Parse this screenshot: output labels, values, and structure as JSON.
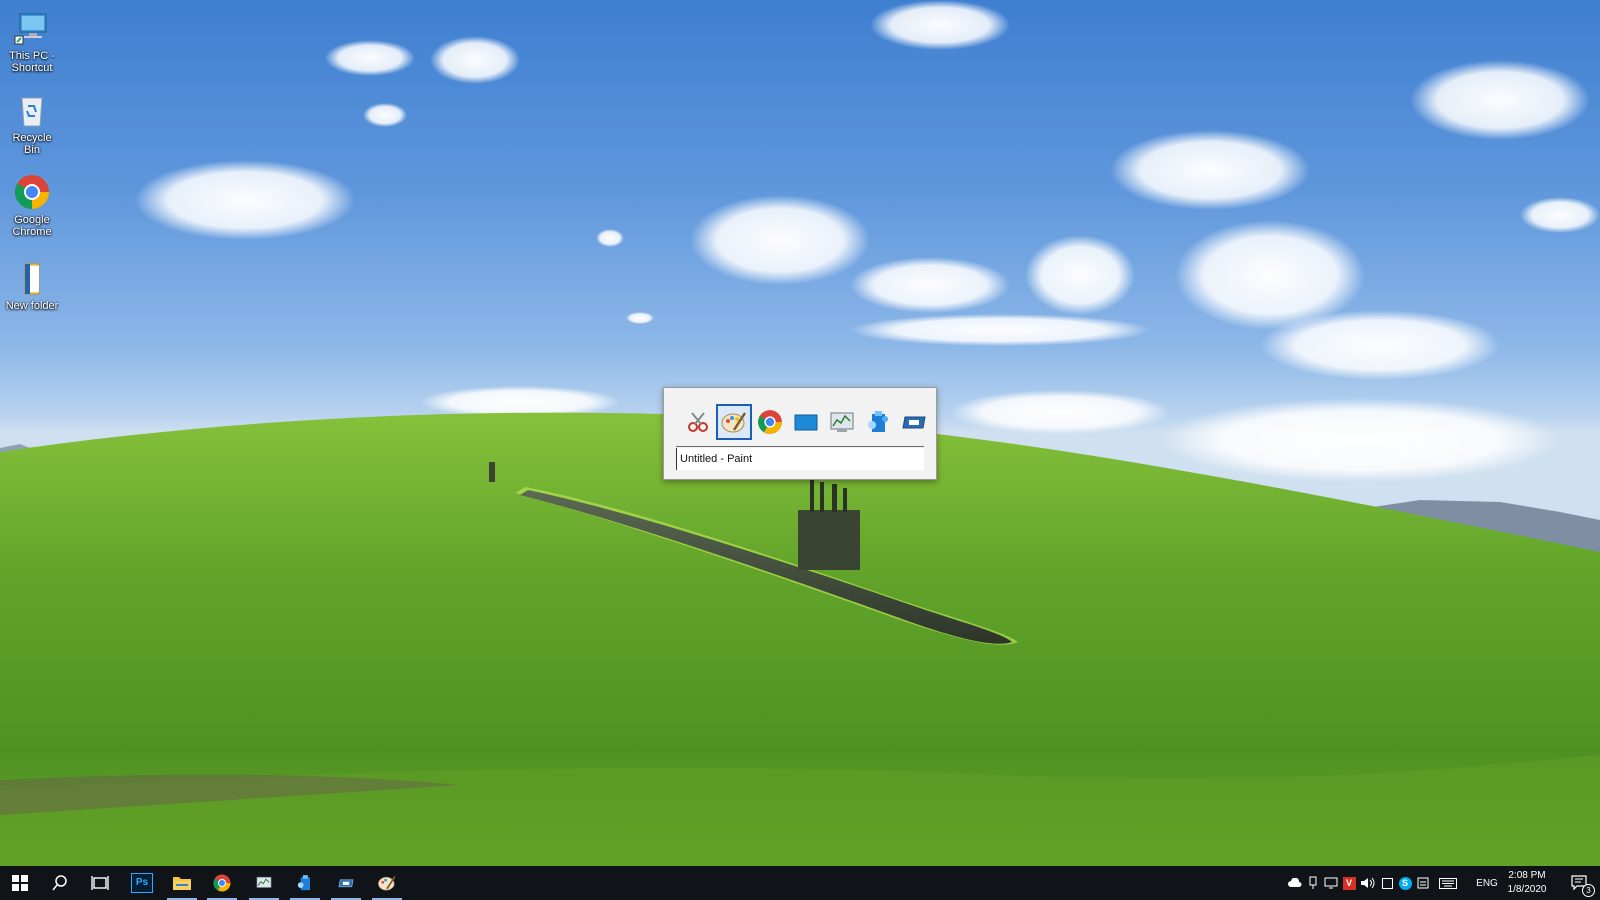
{
  "desktop": {
    "icons": [
      {
        "label": "This PC - Shortcut",
        "icon": "computer-icon"
      },
      {
        "label": "Recycle Bin",
        "icon": "recycle-bin-icon"
      },
      {
        "label": "Google Chrome",
        "icon": "chrome-icon"
      },
      {
        "label": "New folder",
        "icon": "folder-icon"
      }
    ]
  },
  "switcher": {
    "apps": [
      {
        "icon": "snipping-tool-icon",
        "selected": false
      },
      {
        "icon": "paint-icon",
        "selected": true
      },
      {
        "icon": "chrome-icon",
        "selected": false
      },
      {
        "icon": "desktop-icon",
        "selected": false
      },
      {
        "icon": "resource-monitor-icon",
        "selected": false
      },
      {
        "icon": "app-installer-icon",
        "selected": false
      },
      {
        "icon": "remote-app-icon",
        "selected": false
      }
    ],
    "title": "Untitled - Paint"
  },
  "taskbar": {
    "pinned": [
      {
        "icon": "start-icon",
        "running": false
      },
      {
        "icon": "search-icon",
        "running": false
      },
      {
        "icon": "task-view-icon",
        "running": false
      },
      {
        "icon": "photoshop-icon",
        "label": "Ps",
        "running": false
      },
      {
        "icon": "file-explorer-icon",
        "running": true
      },
      {
        "icon": "chrome-icon",
        "running": true
      },
      {
        "icon": "resource-monitor-icon",
        "running": true
      },
      {
        "icon": "app-installer-icon",
        "running": true
      },
      {
        "icon": "remote-app-icon",
        "running": true
      },
      {
        "icon": "paint-icon",
        "running": true
      }
    ],
    "tray": {
      "language": "ENG",
      "time": "2:08 PM",
      "date": "1/8/2020",
      "notifications": "3"
    }
  },
  "colors": {
    "taskbar": "#101418",
    "accent": "#1a5fb4",
    "sky": "#5f97dc",
    "grass": "#6aa92a"
  }
}
